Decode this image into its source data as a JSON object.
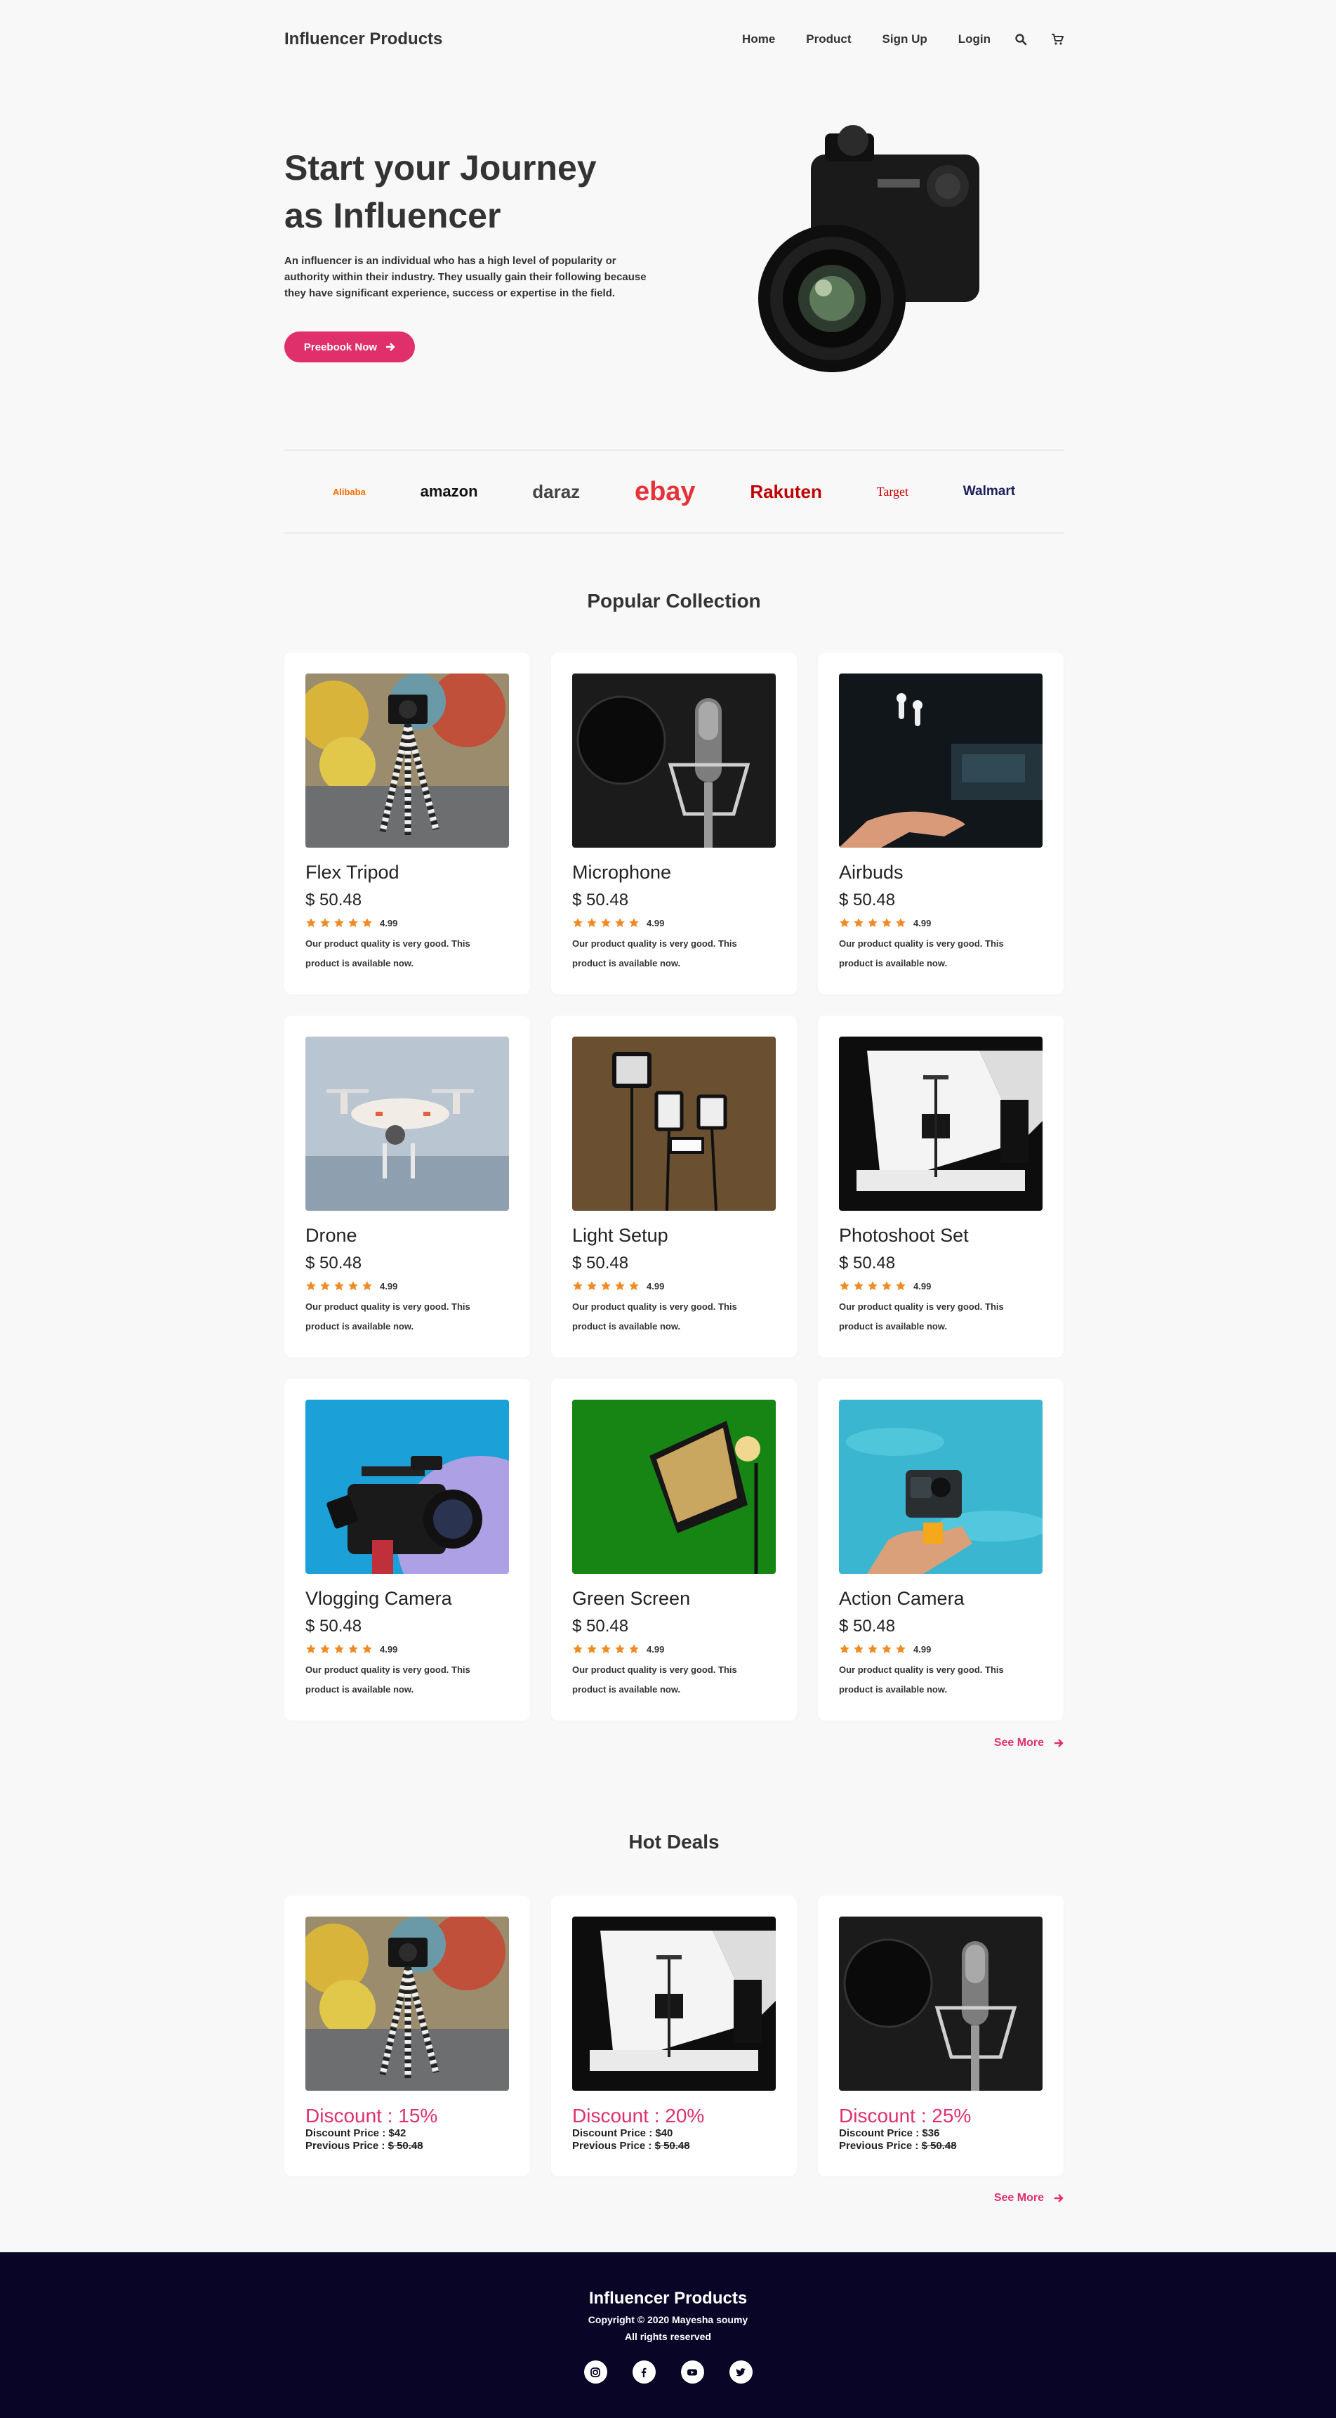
{
  "nav": {
    "brand": "Influencer Products",
    "links": [
      "Home",
      "Product",
      "Sign Up",
      "Login"
    ],
    "search_icon": "search-icon",
    "cart_icon": "cart-icon"
  },
  "hero": {
    "title_line1": "Start your Journey",
    "title_line2": "as Influencer",
    "description": "An influencer is an individual who has a high level of popularity or authority within their industry. They usually gain their following because they have significant experience, success or expertise in the field.",
    "button_label": "Preebook Now",
    "image": "camera-photo"
  },
  "brands": [
    "Alibaba",
    "amazon",
    "daraz",
    "ebay",
    "Rakuten",
    "Target",
    "Walmart"
  ],
  "popular": {
    "title": "Popular Collection",
    "see_more": "See More",
    "products": [
      {
        "name": "Flex Tripod",
        "price": "$ 50.48",
        "rating": "4.99",
        "desc": "Our product quality is very good. This product is available now.",
        "image": "tripod-photo"
      },
      {
        "name": "Microphone",
        "price": "$ 50.48",
        "rating": "4.99",
        "desc": "Our product quality is very good. This product is available now.",
        "image": "microphone-photo"
      },
      {
        "name": "Airbuds",
        "price": "$ 50.48",
        "rating": "4.99",
        "desc": "Our product quality is very good. This product is available now.",
        "image": "airbuds-photo"
      },
      {
        "name": "Drone",
        "price": "$ 50.48",
        "rating": "4.99",
        "desc": "Our product quality is very good. This product is available now.",
        "image": "drone-photo"
      },
      {
        "name": "Light Setup",
        "price": "$ 50.48",
        "rating": "4.99",
        "desc": "Our product quality is very good. This product is available now.",
        "image": "lights-photo"
      },
      {
        "name": "Photoshoot Set",
        "price": "$ 50.48",
        "rating": "4.99",
        "desc": "Our product quality is very good. This product is available now.",
        "image": "photoshoot-photo"
      },
      {
        "name": "Vlogging Camera",
        "price": "$ 50.48",
        "rating": "4.99",
        "desc": "Our product quality is very good. This product is available now.",
        "image": "vlog-camera-photo"
      },
      {
        "name": "Green Screen",
        "price": "$ 50.48",
        "rating": "4.99",
        "desc": "Our product quality is very good. This product is available now.",
        "image": "green-screen-photo"
      },
      {
        "name": "Action Camera",
        "price": "$ 50.48",
        "rating": "4.99",
        "desc": "Our product quality is very good. This product is available now.",
        "image": "action-camera-photo"
      }
    ]
  },
  "deals": {
    "title": "Hot Deals",
    "see_more": "See More",
    "items": [
      {
        "discount": "Discount : 15%",
        "price_label": "Discount Price : $42",
        "prev_label": "Previous Price : ",
        "prev_value": "$ 50.48",
        "image": "tripod-photo"
      },
      {
        "discount": "Discount : 20%",
        "price_label": "Discount Price : $40",
        "prev_label": "Previous Price : ",
        "prev_value": "$ 50.48",
        "image": "photoshoot-photo"
      },
      {
        "discount": "Discount : 25%",
        "price_label": "Discount Price : $36",
        "prev_label": "Previous Price : ",
        "prev_value": "$ 50.48",
        "image": "microphone-photo"
      }
    ]
  },
  "footer": {
    "title": "Influencer Products",
    "copyright": "Copyright © 2020 Mayesha soumy",
    "rights": "All rights reserved",
    "socials": [
      "instagram-icon",
      "facebook-icon",
      "youtube-icon",
      "twitter-icon"
    ]
  },
  "colors": {
    "accent": "#e0306c",
    "star": "#f08a24",
    "footer_bg": "#090527",
    "page_bg": "#f8f8f8"
  }
}
